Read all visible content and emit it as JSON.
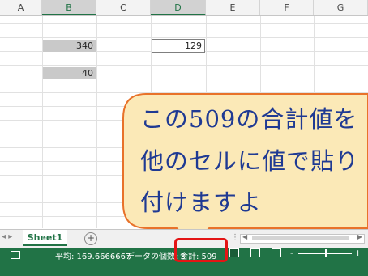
{
  "columns": [
    "A",
    "B",
    "C",
    "D",
    "E",
    "F",
    "G"
  ],
  "cells": {
    "b4": "340",
    "b6": "40",
    "d4": "129"
  },
  "callout": {
    "lines": [
      "この509の合計値を",
      "他のセルに値で貼り",
      "付けますよ"
    ],
    "fill_color": "#fbe9b7",
    "border_color": "#e8722a",
    "text_color": "#1f3a93"
  },
  "sheet_tabs": {
    "active": "Sheet1",
    "add_symbol": "+"
  },
  "status_bar": {
    "average": "平均: 169.6666667",
    "count": "データの個数: 3",
    "sum": "合計: 509",
    "highlight_color": "#e31515",
    "zoom_minus": "-",
    "zoom_plus": "+"
  },
  "colors": {
    "accent": "#217346",
    "selected_cell": "#c9c9c9"
  }
}
